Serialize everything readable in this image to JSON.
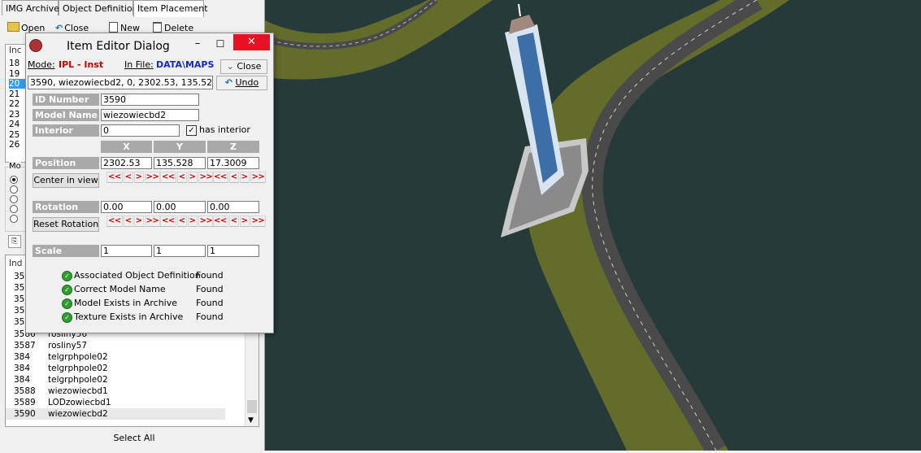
{
  "tabs": [
    "IMG Archive",
    "Object Definition",
    "Item Placement"
  ],
  "toolbar": {
    "open": "Open",
    "close": "Close",
    "new": "New",
    "delete": "Delete"
  },
  "top_list": {
    "header": "Inc",
    "rows": [
      "18",
      "19",
      "20",
      "21",
      "22",
      "23",
      "24",
      "25",
      "26"
    ]
  },
  "mode_group": {
    "label": "Mo"
  },
  "bottom_list": {
    "header": "Ind",
    "hidden_rows": [
      "35",
      "35",
      "35",
      "35",
      "35"
    ],
    "rows": [
      {
        "id": "3586",
        "name": "rosliny56"
      },
      {
        "id": "3587",
        "name": "rosliny57"
      },
      {
        "id": "384",
        "name": "telgrphpole02"
      },
      {
        "id": "384",
        "name": "telgrphpole02"
      },
      {
        "id": "384",
        "name": "telgrphpole02"
      },
      {
        "id": "3588",
        "name": "wiezowiecbd1"
      },
      {
        "id": "3589",
        "name": "LODzowiecbd1"
      },
      {
        "id": "3590",
        "name": "wiezowiecbd2"
      }
    ]
  },
  "select_all": "Select All",
  "dialog": {
    "title": "Item Editor Dialog",
    "mode_label": "Mode:",
    "mode_value": "IPL - Inst",
    "infile_label": "In File:",
    "infile_value": "DATA\\MAPS",
    "close_button": "Close",
    "undo_button": "Undo",
    "raw_line": "3590, wiezowiecbd2, 0, 2302.53, 135.528, 17",
    "id_label": "ID Number",
    "id_value": "3590",
    "model_label": "Model Name",
    "model_value": "wiezowiecbd2",
    "interior_label": "Interior",
    "interior_value": "0",
    "has_interior": "has interior",
    "axes": [
      "X",
      "Y",
      "Z"
    ],
    "position_label": "Position",
    "position": [
      "2302.53",
      "135.528",
      "17.3009"
    ],
    "center_button": "Center in view",
    "rotation_label": "Rotation",
    "rotation": [
      "0.00",
      "0.00",
      "0.00"
    ],
    "reset_button": "Reset Rotation",
    "scale_label": "Scale",
    "scale": [
      "1",
      "1",
      "1"
    ],
    "checks": [
      {
        "label": "Associated Object Definition",
        "status": "Found"
      },
      {
        "label": "Correct Model Name",
        "status": "Found"
      },
      {
        "label": "Model Exists in Archive",
        "status": "Found"
      },
      {
        "label": "Texture Exists in Archive",
        "status": "Found"
      }
    ],
    "arrows": {
      "ll": "<<",
      "l": "<",
      "r": ">",
      "rr": ">>"
    }
  },
  "colors": {
    "water": "#273a3a",
    "grass": "#646c2c",
    "road": "#4a4a4a",
    "mode_red": "#c80000",
    "file_blue": "#1428c8"
  }
}
